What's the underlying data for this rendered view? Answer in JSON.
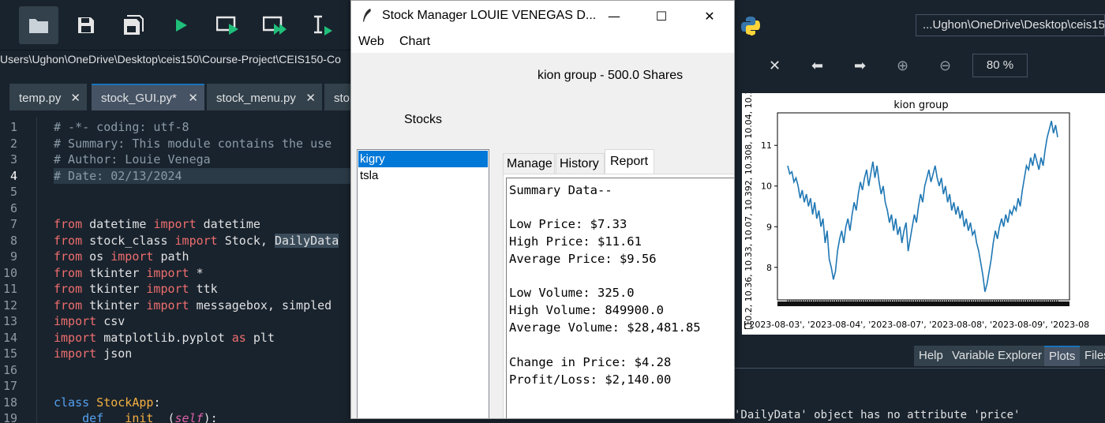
{
  "ide": {
    "path_bar": "Users\\Ughon\\OneDrive\\Desktop\\ceis150\\Course-Project\\CEIS150-Co",
    "cwd": "...Ughon\\OneDrive\\Desktop\\ceis150",
    "zoom": "80 %",
    "tabs": [
      {
        "label": "temp.py"
      },
      {
        "label": "stock_GUI.py*"
      },
      {
        "label": "stock_menu.py"
      },
      {
        "label": "sto"
      }
    ],
    "tab_close": "✕",
    "line_numbers": [
      "1",
      "2",
      "3",
      "4",
      "5",
      "6",
      "7",
      "8",
      "9",
      "10",
      "11",
      "12",
      "13",
      "14",
      "15",
      "16",
      "17",
      "18",
      "19"
    ],
    "code": {
      "l1": "# -*- coding: utf-8",
      "l2": "# Summary: This module contains the use",
      "l3": "# Author: Louie Venega",
      "l4": "# Date: 02/13/2024",
      "l7_from": "from",
      "l7_mod": " datetime ",
      "l7_import": "import",
      "l7_rest": " datetime",
      "l8_from": "from",
      "l8_mod": " stock_class ",
      "l8_import": "import",
      "l8_rest": " Stock, ",
      "l8_sel": "DailyData",
      "l9_from": "from",
      "l9_mod": " os ",
      "l9_import": "import",
      "l9_rest": " path",
      "l10_from": "from",
      "l10_mod": " tkinter ",
      "l10_import": "import",
      "l10_rest": " *",
      "l11_from": "from",
      "l11_mod": " tkinter ",
      "l11_import": "import",
      "l11_rest": " ttk",
      "l12_from": "from",
      "l12_mod": " tkinter ",
      "l12_import": "import",
      "l12_rest": " messagebox, simpled",
      "l13_import": "import",
      "l13_rest": " csv",
      "l14_import": "import",
      "l14_mod": " matplotlib.pyplot ",
      "l14_as": "as",
      "l14_rest": " plt",
      "l15_import": "import",
      "l15_rest": " json",
      "l18_class": "class",
      "l18_name": " StockApp",
      "l18_rest": ":",
      "l19_indent": "    ",
      "l19_def": "def",
      "l19_name": " __init__",
      "l19_paren": "(",
      "l19_self": "self",
      "l19_end": "):"
    },
    "pane_tabs": [
      "Help",
      "Variable Explorer",
      "Plots",
      "Files"
    ],
    "console_text": "'DailyData' object has no attribute 'price'",
    "plot": {
      "title": "kion group",
      "y_ticks": [
        "8",
        "9",
        "10",
        "11"
      ],
      "y_axis_label": "[10.2, 10.36, 10.33, 10.07, 10.392, 10.308, 10.04, 10.1",
      "x_axis_label": "['2023-08-03', '2023-08-04', '2023-08-07', '2023-08-08', '2023-08-09', '2023-08",
      "line_color": "#1f77b4"
    }
  },
  "window": {
    "title": "Stock Manager LOUIE VENEGAS D...",
    "controls": {
      "minimize": "—",
      "maximize": "☐",
      "close": "✕"
    },
    "menu": [
      "Web",
      "Chart"
    ],
    "heading": "kion group - 500.0 Shares",
    "stocks_label": "Stocks",
    "stocks": [
      {
        "symbol": "kigry",
        "selected": true
      },
      {
        "symbol": "tsla",
        "selected": false
      }
    ],
    "tabs": [
      "Manage",
      "History",
      "Report"
    ],
    "active_tab": "Report",
    "report": {
      "summary": "Summary Data--",
      "low_price": "Low Price: $7.33",
      "high_price": "High Price: $11.61",
      "avg_price": "Average Price: $9.56",
      "low_volume": "Low Volume: 325.0",
      "high_volume": "High Volume: 849900.0",
      "avg_volume": "Average Volume: $28,481.85",
      "change": "Change in Price: $4.28",
      "profit": "Profit/Loss: $2,140.00"
    }
  },
  "chart_data": {
    "type": "line",
    "title": "kion group",
    "ylim": [
      7.2,
      11.8
    ],
    "y_ticks": [
      8,
      9,
      10,
      11
    ],
    "series": [
      {
        "values": [
          10.5,
          10.3,
          10.35,
          10.1,
          10.2,
          10.0,
          9.7,
          9.9,
          9.6,
          9.8,
          9.5,
          9.7,
          9.3,
          9.6,
          9.2,
          9.4,
          9.0,
          9.2,
          8.6,
          8.9,
          8.2,
          8.0,
          7.7,
          7.9,
          8.4,
          8.7,
          8.9,
          8.6,
          9.0,
          9.2,
          8.9,
          9.3,
          9.6,
          9.4,
          9.8,
          10.1,
          9.9,
          10.2,
          10.4,
          10.0,
          10.3,
          10.6,
          10.2,
          10.5,
          10.1,
          9.8,
          10.0,
          9.6,
          9.4,
          9.1,
          9.3,
          8.9,
          9.2,
          8.8,
          9.0,
          8.6,
          8.9,
          9.1,
          8.4,
          8.7,
          9.0,
          9.3,
          9.1,
          9.5,
          9.8,
          9.6,
          10.0,
          10.2,
          10.4,
          10.1,
          10.3,
          10.5,
          10.2,
          10.0,
          10.2,
          9.8,
          10.0,
          9.6,
          9.8,
          9.4,
          9.6,
          9.3,
          9.5,
          9.2,
          9.4,
          9.0,
          9.2,
          8.9,
          9.1,
          8.8,
          8.9,
          8.6,
          8.4,
          8.1,
          7.8,
          7.4,
          7.6,
          7.9,
          8.2,
          8.6,
          8.9,
          8.7,
          9.0,
          9.2,
          9.0,
          9.3,
          9.1,
          9.4,
          9.3,
          9.5,
          9.4,
          9.7,
          9.5,
          9.9,
          10.2,
          10.5,
          10.4,
          10.7,
          10.5,
          10.8,
          10.6,
          10.4,
          10.7,
          10.5,
          10.9,
          11.2,
          11.4,
          11.6,
          11.3,
          11.5,
          11.2
        ]
      }
    ]
  }
}
